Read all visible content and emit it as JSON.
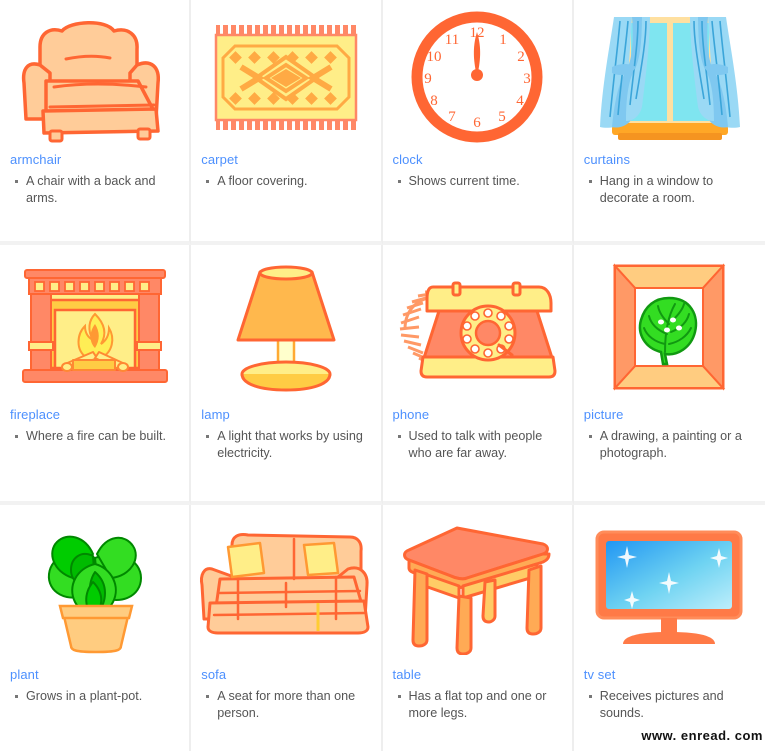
{
  "palette": {
    "term_color": "#4d90fe",
    "definition_color": "#555555",
    "card_background": "#ffffff",
    "page_background": "#e8e8e8",
    "orange_stroke": "#ff6633",
    "peach_fill": "#ffcc99",
    "yellow_fill": "#ffee88",
    "amber_fill": "#ffb84d",
    "green_fill": "#33dd22",
    "sky_blue": "#7fe5f0",
    "curtain_blue": "#7fc8f0"
  },
  "watermark": {
    "text": "www. enread. com"
  },
  "cards": [
    {
      "term": "armchair",
      "icon": "armchair-illustration",
      "definitions": [
        "A chair with a back and arms."
      ]
    },
    {
      "term": "carpet",
      "icon": "carpet-illustration",
      "definitions": [
        "A floor covering."
      ]
    },
    {
      "term": "clock",
      "icon": "clock-illustration",
      "definitions": [
        "Shows current time."
      ],
      "clock_numbers": [
        "12",
        "1",
        "2",
        "3",
        "4",
        "5",
        "6",
        "7",
        "8",
        "9",
        "10",
        "11"
      ]
    },
    {
      "term": "curtains",
      "icon": "curtains-illustration",
      "definitions": [
        "Hang in a window to decorate a room."
      ]
    },
    {
      "term": "fireplace",
      "icon": "fireplace-illustration",
      "definitions": [
        "Where a fire can be built."
      ]
    },
    {
      "term": "lamp",
      "icon": "lamp-illustration",
      "definitions": [
        "A light that works by using electricity."
      ]
    },
    {
      "term": "phone",
      "icon": "phone-illustration",
      "definitions": [
        "Used to talk with people who are far away."
      ]
    },
    {
      "term": "picture",
      "icon": "picture-illustration",
      "definitions": [
        "A drawing, a painting or a photograph."
      ]
    },
    {
      "term": "plant",
      "icon": "plant-illustration",
      "definitions": [
        "Grows in a plant-pot."
      ]
    },
    {
      "term": "sofa",
      "icon": "sofa-illustration",
      "definitions": [
        "A seat for more than one person."
      ]
    },
    {
      "term": "table",
      "icon": "table-illustration",
      "definitions": [
        "Has a flat top and one or more legs."
      ]
    },
    {
      "term": "tv set",
      "icon": "tv-set-illustration",
      "definitions": [
        "Receives pictures and sounds."
      ]
    }
  ]
}
